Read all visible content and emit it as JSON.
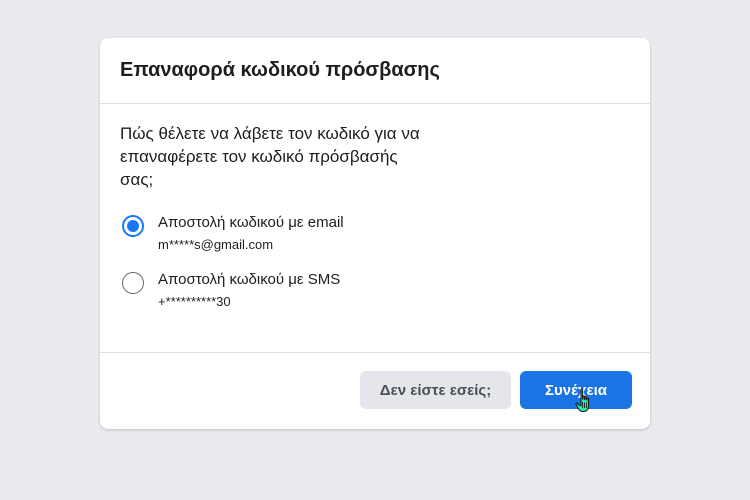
{
  "dialog": {
    "title": "Επαναφορά κωδικού πρόσβασης",
    "question": "Πώς θέλετε να λάβετε τον κωδικό για να επαναφέρετε τον κωδικό πρόσβασής σας;",
    "options": [
      {
        "label": "Αποστολή κωδικού με email",
        "detail": "m*****s@gmail.com",
        "selected": true
      },
      {
        "label": "Αποστολή κωδικού με SMS",
        "detail": "+**********30",
        "selected": false
      }
    ],
    "buttons": {
      "not_you": "Δεν είστε εσείς;",
      "continue": "Συνέχεια"
    }
  },
  "colors": {
    "background": "#e9ebee",
    "primary": "#1b74e4",
    "radio_selected": "#1877f2",
    "secondary_button": "#e4e6eb"
  },
  "icons": {
    "cursor": "hand-pointer-icon"
  }
}
